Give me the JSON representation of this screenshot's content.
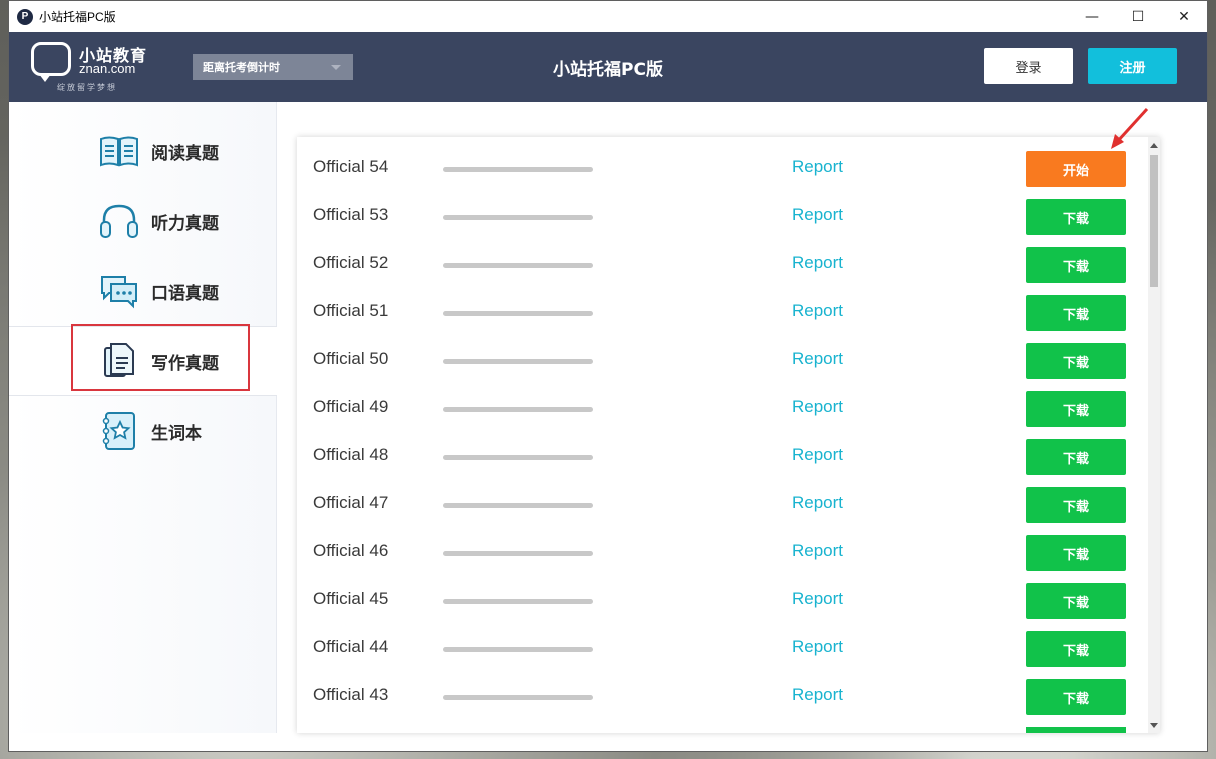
{
  "window": {
    "title": "小站托福PC版",
    "controls": {
      "minimize": "—",
      "maximize": "☐",
      "close": "✕"
    }
  },
  "header": {
    "logo_cn": "小站教育",
    "logo_en": "znan.com",
    "logo_slogan": "绽放留学梦想",
    "countdown_label": "距离托考倒计时",
    "title": "小站托福PC版",
    "login_label": "登录",
    "register_label": "注册"
  },
  "sidebar": {
    "items": [
      {
        "label": "阅读真题",
        "icon": "book-icon"
      },
      {
        "label": "听力真题",
        "icon": "headphones-icon"
      },
      {
        "label": "口语真题",
        "icon": "chat-icon"
      },
      {
        "label": "写作真题",
        "icon": "document-icon",
        "active": true
      },
      {
        "label": "生词本",
        "icon": "notebook-star-icon"
      }
    ]
  },
  "list": {
    "rows": [
      {
        "name": "Official 54",
        "report": "Report",
        "action": "开始",
        "state": "start",
        "progress": 0
      },
      {
        "name": "Official 53",
        "report": "Report",
        "action": "下载",
        "state": "download",
        "progress": 0
      },
      {
        "name": "Official 52",
        "report": "Report",
        "action": "下载",
        "state": "download",
        "progress": 0
      },
      {
        "name": "Official 51",
        "report": "Report",
        "action": "下载",
        "state": "download",
        "progress": 0
      },
      {
        "name": "Official 50",
        "report": "Report",
        "action": "下载",
        "state": "download",
        "progress": 0
      },
      {
        "name": "Official 49",
        "report": "Report",
        "action": "下载",
        "state": "download",
        "progress": 0
      },
      {
        "name": "Official 48",
        "report": "Report",
        "action": "下载",
        "state": "download",
        "progress": 0
      },
      {
        "name": "Official 47",
        "report": "Report",
        "action": "下载",
        "state": "download",
        "progress": 0
      },
      {
        "name": "Official 46",
        "report": "Report",
        "action": "下载",
        "state": "download",
        "progress": 0
      },
      {
        "name": "Official 45",
        "report": "Report",
        "action": "下载",
        "state": "download",
        "progress": 0
      },
      {
        "name": "Official 44",
        "report": "Report",
        "action": "下载",
        "state": "download",
        "progress": 0
      },
      {
        "name": "Official 43",
        "report": "Report",
        "action": "下载",
        "state": "download",
        "progress": 0
      }
    ]
  },
  "colors": {
    "header_bg": "#3a4560",
    "register_bg": "#12bfdc",
    "start_button": "#f97a1f",
    "download_button": "#11c24a",
    "report_link": "#18b3cf",
    "highlight_box": "#d9363e"
  }
}
